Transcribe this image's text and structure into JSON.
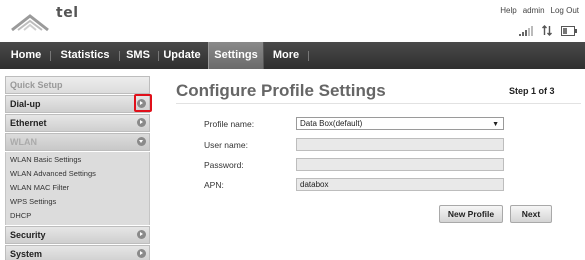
{
  "brand": {
    "logo_text": "tel"
  },
  "top_links": {
    "help": "Help",
    "user": "admin",
    "logout": "Log Out"
  },
  "status_icons": [
    "signal-bars-icon",
    "data-transfer-icon",
    "battery-icon"
  ],
  "nav": {
    "items": [
      "Home",
      "Statistics",
      "SMS",
      "Update",
      "Settings",
      "More"
    ],
    "active": "Settings"
  },
  "sidebar": {
    "quick_setup": "Quick Setup",
    "dialup": "Dial-up",
    "ethernet": "Ethernet",
    "wlan": "WLAN",
    "wlan_items": [
      "WLAN Basic Settings",
      "WLAN Advanced Settings",
      "WLAN MAC Filter",
      "WPS Settings",
      "DHCP"
    ],
    "security": "Security",
    "system": "System"
  },
  "main": {
    "title": "Configure Profile Settings",
    "step": "Step 1 of 3",
    "fields": {
      "profile_name": {
        "label": "Profile name:",
        "value": "Data Box(default)"
      },
      "user_name": {
        "label": "User name:",
        "value": ""
      },
      "password": {
        "label": "Password:",
        "value": ""
      },
      "apn": {
        "label": "APN:",
        "value": "databox"
      }
    },
    "buttons": {
      "new_profile": "New Profile",
      "next": "Next"
    }
  },
  "colors": {
    "nav_bg": "#3a3a3a",
    "nav_active": "#777777",
    "highlight": "#e0101a"
  }
}
